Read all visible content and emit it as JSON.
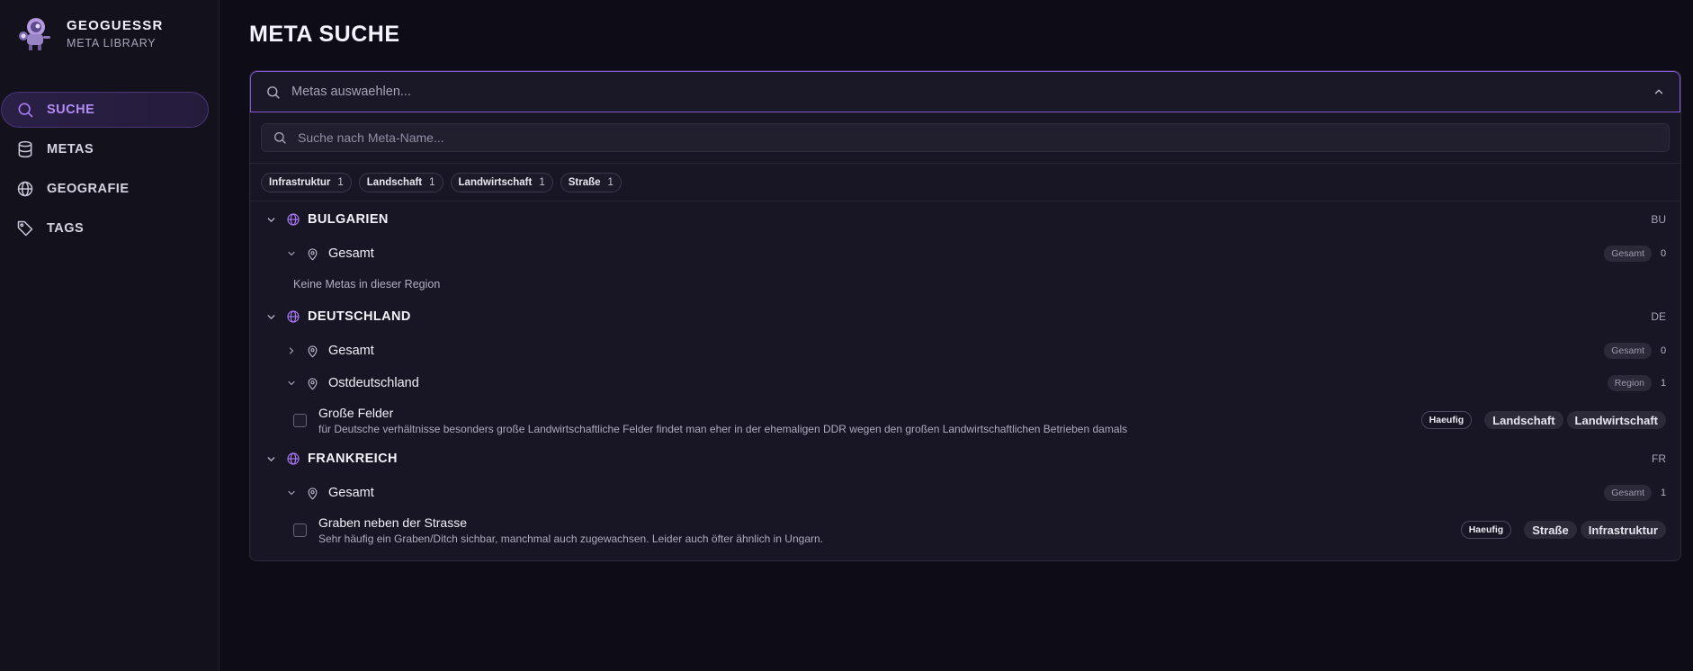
{
  "brand": {
    "title": "GEOGUESSR",
    "subtitle": "META LIBRARY"
  },
  "nav": [
    {
      "label": "SUCHE",
      "icon": "search-icon",
      "active": true
    },
    {
      "label": "METAS",
      "icon": "database-icon",
      "active": false
    },
    {
      "label": "GEOGRAFIE",
      "icon": "globe-icon",
      "active": false
    },
    {
      "label": "TAGS",
      "icon": "tag-icon",
      "active": false
    }
  ],
  "page": {
    "title": "META SUCHE"
  },
  "selector": {
    "placeholder": "Metas auswaehlen..."
  },
  "search": {
    "placeholder": "Suche nach Meta-Name..."
  },
  "filter_chips": [
    {
      "label": "Infrastruktur",
      "count": "1"
    },
    {
      "label": "Landschaft",
      "count": "1"
    },
    {
      "label": "Landwirtschaft",
      "count": "1"
    },
    {
      "label": "Straße",
      "count": "1"
    }
  ],
  "countries": {
    "bulgarien": {
      "name": "BULGARIEN",
      "code": "BU",
      "regions": [
        {
          "name": "Gesamt",
          "badge": "Gesamt",
          "count": "0"
        }
      ],
      "empty_note": "Keine Metas in dieser Region"
    },
    "deutschland": {
      "name": "DEUTSCHLAND",
      "code": "DE",
      "regions": [
        {
          "name": "Gesamt",
          "badge": "Gesamt",
          "count": "0"
        },
        {
          "name": "Ostdeutschland",
          "badge": "Region",
          "count": "1"
        }
      ],
      "metas": [
        {
          "title": "Große Felder",
          "description": "für Deutsche verhältnisse besonders große Landwirtschaftliche Felder findet man eher in der ehemaligen DDR wegen den großen Landwirtschaftlichen Betrieben damals",
          "frequency": "Haeufig",
          "tags": [
            "Landschaft",
            "Landwirtschaft"
          ]
        }
      ]
    },
    "frankreich": {
      "name": "FRANKREICH",
      "code": "FR",
      "regions": [
        {
          "name": "Gesamt",
          "badge": "Gesamt",
          "count": "1"
        }
      ],
      "metas": [
        {
          "title": "Graben neben der Strasse",
          "description": "Sehr häufig ein Graben/Ditch sichbar, manchmal auch zugewachsen. Leider auch öfter ähnlich in Ungarn.",
          "frequency": "Haeufig",
          "tags": [
            "Straße",
            "Infrastruktur"
          ]
        }
      ]
    }
  },
  "colors": {
    "accent": "#a877f3",
    "background": "#0e0d17",
    "panel": "#181624"
  }
}
